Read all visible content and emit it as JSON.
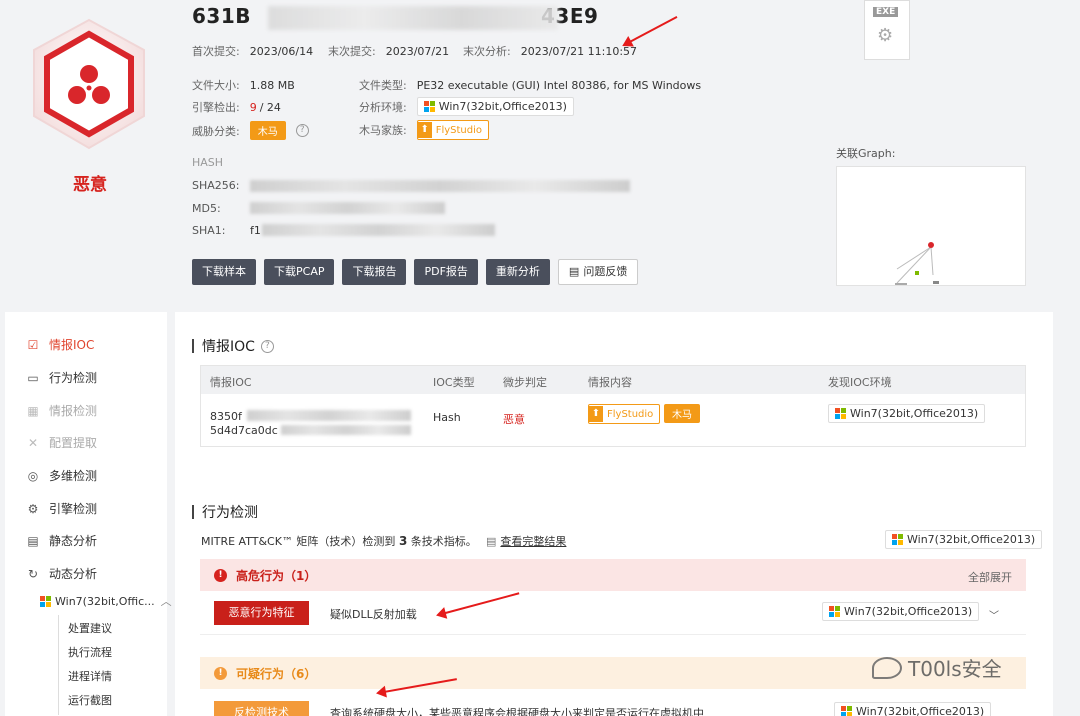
{
  "header": {
    "hash_visible": "631B",
    "hash_tail": "43E9",
    "first_submit_label": "首次提交:",
    "first_submit": "2023/06/14",
    "last_submit_label": "末次提交:",
    "last_submit": "2023/07/21",
    "last_analysis_label": "末次分析:",
    "last_analysis": "2023/07/21 11:10:57",
    "verdict": "恶意"
  },
  "details": {
    "size_label": "文件大小:",
    "size": "1.88 MB",
    "type_label": "文件类型:",
    "type": "PE32 executable (GUI) Intel 80386, for MS Windows",
    "engine_label": "引擎检出:",
    "engine_hits": "9",
    "engine_total": "/ 24",
    "env_label": "分析环境:",
    "env": "Win7(32bit,Office2013)",
    "threat_label": "威胁分类:",
    "threat": "木马",
    "family_label": "木马家族:",
    "family": "FlyStudio"
  },
  "hashes": {
    "title": "HASH",
    "sha256_label": "SHA256:",
    "md5_label": "MD5:",
    "sha1_label": "SHA1:",
    "sha1_prefix": "f1"
  },
  "actions": {
    "download_sample": "下载样本",
    "download_pcap": "下载PCAP",
    "download_report": "下载报告",
    "pdf_report": "PDF报告",
    "reanalyze": "重新分析",
    "feedback": "问题反馈"
  },
  "file_icon_label": "EXE",
  "graph_label": "关联Graph:",
  "nav": {
    "items": [
      {
        "label": "情报IOC",
        "icon": "clipboard-icon"
      },
      {
        "label": "行为检测",
        "icon": "monitor-icon"
      },
      {
        "label": "情报检测",
        "icon": "grid-icon"
      },
      {
        "label": "配置提取",
        "icon": "tools-icon"
      },
      {
        "label": "多维检测",
        "icon": "scan-icon"
      },
      {
        "label": "引擎检测",
        "icon": "gear-icon"
      },
      {
        "label": "静态分析",
        "icon": "document-icon"
      },
      {
        "label": "动态分析",
        "icon": "refresh-icon"
      }
    ],
    "env": "Win7(32bit,Offic...",
    "sub_items": [
      "处置建议",
      "执行流程",
      "进程详情",
      "运行截图"
    ]
  },
  "ioc": {
    "title": "情报IOC",
    "headers": [
      "情报IOC",
      "IOC类型",
      "微步判定",
      "情报内容",
      "发现IOC环境"
    ],
    "row": {
      "ioc_line1": "8350f",
      "ioc_line2": "5d4d7ca0dc",
      "type": "Hash",
      "verdict": "恶意",
      "family": "FlyStudio",
      "threat": "木马",
      "env": "Win7(32bit,Office2013)"
    }
  },
  "behavior": {
    "title": "行为检测",
    "mitre_prefix": "MITRE ATT&CK™ 矩阵（技术）检测到",
    "mitre_count": "3",
    "mitre_suffix": "条技术指标。",
    "view_full": "查看完整结果",
    "env": "Win7(32bit,Office2013)",
    "high_title": "高危行为（1）",
    "expand_all": "全部展开",
    "high_tag": "恶意行为特征",
    "high_text": "疑似DLL反射加载",
    "high_env": "Win7(32bit,Office2013)",
    "sus_title": "可疑行为（6）",
    "sus_tag": "反检测技术",
    "sus_text": "查询系统硬盘大小，某些恶意程序会根据硬盘大小来判定是否运行在虚拟机中",
    "sus_env": "Win7(32bit,Office2013)"
  },
  "watermark": "T00ls安全",
  "colors": {
    "danger": "#d6231e",
    "warning": "#f39a17",
    "dark_button": "#4a4f5c"
  }
}
